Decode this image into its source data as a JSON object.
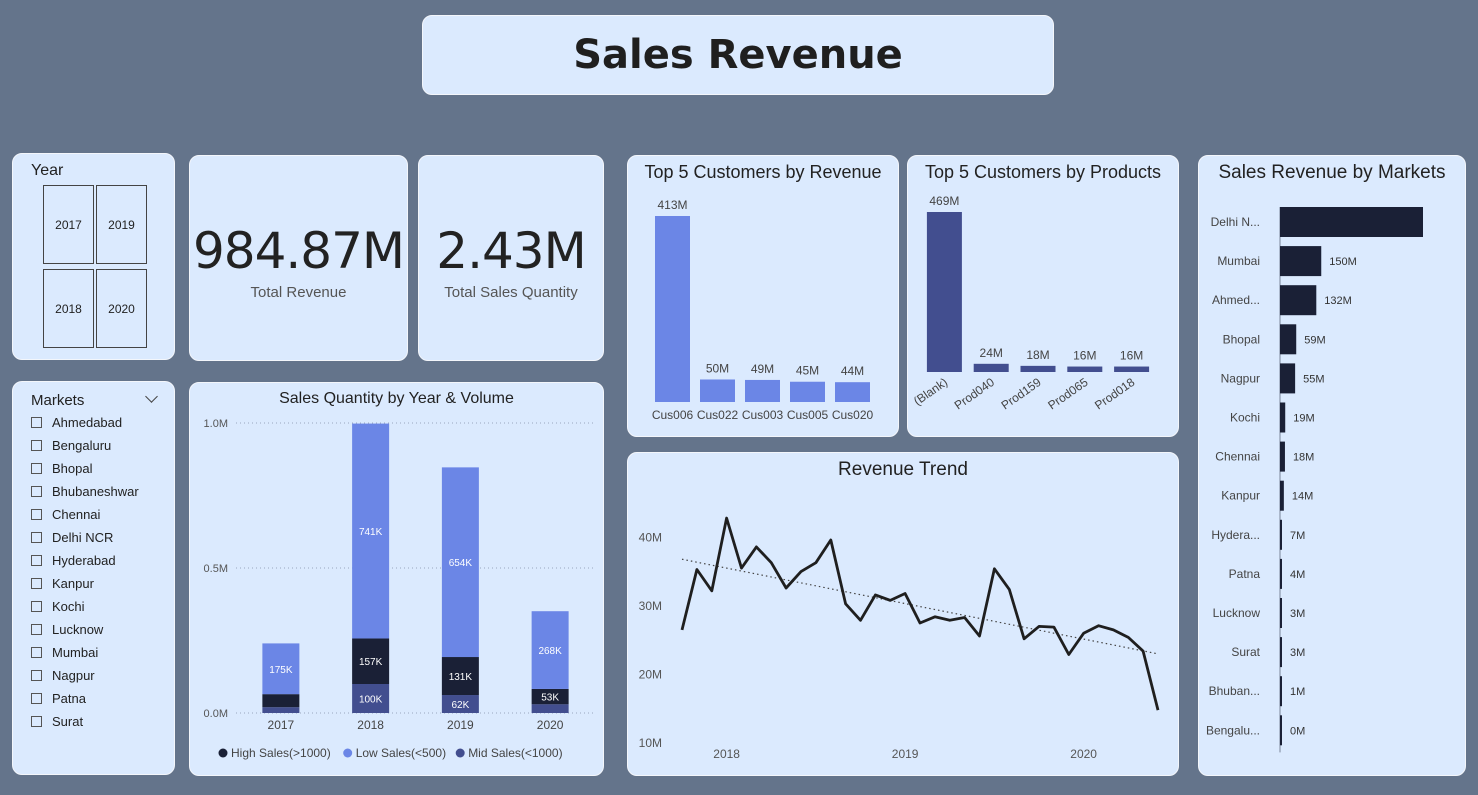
{
  "page_title": "Sales Revenue",
  "year_slicer": {
    "label": "Year",
    "years": [
      "2017",
      "2019",
      "2018",
      "2020"
    ]
  },
  "kpis": {
    "revenue": {
      "value": "984.87M",
      "label": "Total Revenue"
    },
    "quantity": {
      "value": "2.43M",
      "label": "Total Sales Quantity"
    }
  },
  "markets_slicer": {
    "label": "Markets",
    "items": [
      "Ahmedabad",
      "Bengaluru",
      "Bhopal",
      "Bhubaneshwar",
      "Chennai",
      "Delhi NCR",
      "Hyderabad",
      "Kanpur",
      "Kochi",
      "Lucknow",
      "Mumbai",
      "Nagpur",
      "Patna",
      "Surat"
    ]
  },
  "chart_data": [
    {
      "id": "qty_year_volume",
      "type": "bar",
      "title": "Sales Quantity by Year & Volume",
      "categories": [
        "2017",
        "2018",
        "2019",
        "2020"
      ],
      "series": [
        {
          "name": "Mid Sales(<1000)",
          "color": "#424e8f",
          "values": [
            0.02,
            0.1,
            0.062,
            0.03
          ],
          "labels": [
            "",
            "100K",
            "62K",
            ""
          ]
        },
        {
          "name": "High Sales(>1000)",
          "color": "#1a2036",
          "values": [
            0.045,
            0.157,
            0.131,
            0.053
          ],
          "labels": [
            "",
            "157K",
            "131K",
            "53K"
          ]
        },
        {
          "name": "Low Sales(<500)",
          "color": "#6b86e6",
          "values": [
            0.175,
            0.741,
            0.654,
            0.268
          ],
          "labels": [
            "175K",
            "741K",
            "654K",
            "268K"
          ]
        }
      ],
      "legend_order": [
        "High Sales(>1000)",
        "Low Sales(<500)",
        "Mid Sales(<1000)"
      ],
      "yticks": [
        "1.0M",
        "0.5M",
        "0.0M"
      ],
      "ylim": [
        0,
        1.0
      ],
      "grid": true,
      "legend": "bottom"
    },
    {
      "id": "top_customers_revenue",
      "type": "bar",
      "title": "Top 5 Customers by Revenue",
      "categories": [
        "Cus006",
        "Cus022",
        "Cus003",
        "Cus005",
        "Cus020"
      ],
      "values": [
        413,
        50,
        49,
        45,
        44
      ],
      "labels": [
        "413M",
        "50M",
        "49M",
        "45M",
        "44M"
      ],
      "color": "#6b86e6",
      "ylim": [
        0,
        413
      ]
    },
    {
      "id": "top_customers_products",
      "type": "bar",
      "title": "Top 5 Customers by Products",
      "categories": [
        "(Blank)",
        "Prod040",
        "Prod159",
        "Prod065",
        "Prod018"
      ],
      "values": [
        469,
        24,
        18,
        16,
        16
      ],
      "labels": [
        "469M",
        "24M",
        "18M",
        "16M",
        "16M"
      ],
      "color": "#424e8f",
      "ylim": [
        0,
        469
      ]
    },
    {
      "id": "revenue_trend",
      "type": "line",
      "title": "Revenue Trend",
      "x": [
        "2017-10",
        "2017-11",
        "2017-12",
        "2018-01",
        "2018-02",
        "2018-03",
        "2018-04",
        "2018-05",
        "2018-06",
        "2018-07",
        "2018-08",
        "2018-09",
        "2018-10",
        "2018-11",
        "2018-12",
        "2019-01",
        "2019-02",
        "2019-03",
        "2019-04",
        "2019-05",
        "2019-06",
        "2019-07",
        "2019-08",
        "2019-09",
        "2019-10",
        "2019-11",
        "2019-12",
        "2020-01",
        "2020-02",
        "2020-03",
        "2020-04",
        "2020-05",
        "2020-06"
      ],
      "values": [
        26.5,
        35.3,
        32.2,
        42.8,
        35.5,
        38.6,
        36.3,
        32.6,
        35.0,
        36.3,
        39.6,
        30.3,
        27.9,
        31.6,
        30.8,
        31.8,
        27.5,
        28.4,
        27.9,
        28.3,
        25.6,
        35.4,
        32.4,
        25.2,
        27.0,
        26.9,
        22.9,
        26.0,
        27.1,
        26.5,
        25.4,
        23.4,
        14.8
      ],
      "trend": [
        36.8,
        23.0
      ],
      "yticks": [
        "40M",
        "30M",
        "20M",
        "10M"
      ],
      "ylim": [
        10,
        45
      ],
      "xticks": [
        "2018",
        "2019",
        "2020"
      ],
      "color": "#1f1f1f"
    },
    {
      "id": "revenue_by_markets",
      "type": "bar",
      "orientation": "horizontal",
      "title": "Sales Revenue by Markets",
      "categories": [
        "Delhi N...",
        "Mumbai",
        "Ahmed...",
        "Bhopal",
        "Nagpur",
        "Kochi",
        "Chennai",
        "Kanpur",
        "Hydera...",
        "Patna",
        "Lucknow",
        "Surat",
        "Bhuban...",
        "Bengalu..."
      ],
      "values": [
        520,
        150,
        132,
        59,
        55,
        19,
        18,
        14,
        7,
        4,
        3,
        3,
        1,
        0.4
      ],
      "labels": [
        "",
        "150M",
        "132M",
        "59M",
        "55M",
        "19M",
        "18M",
        "14M",
        "7M",
        "4M",
        "3M",
        "3M",
        "1M",
        "0M"
      ],
      "color": "#1a2036"
    }
  ]
}
